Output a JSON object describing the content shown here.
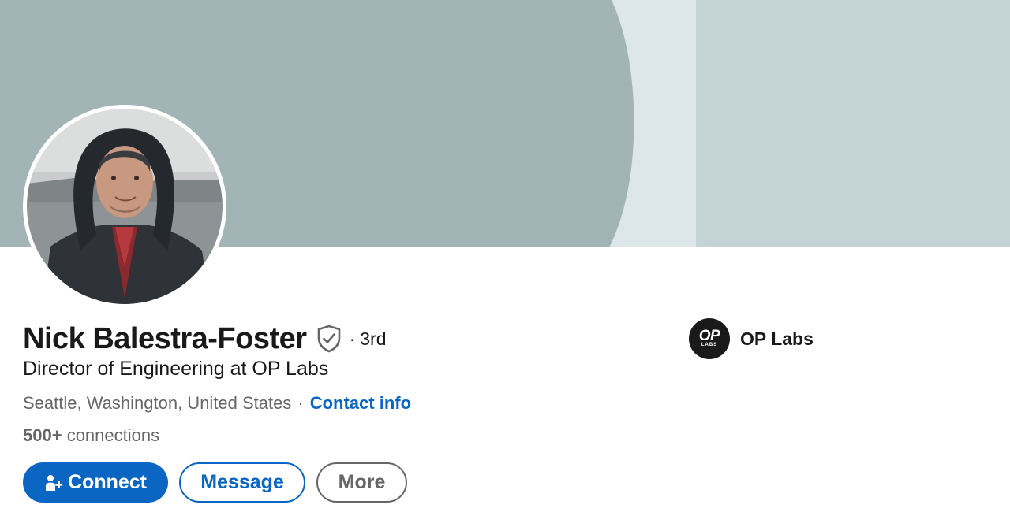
{
  "profile": {
    "name": "Nick Balestra-Foster",
    "degree_separator": "·",
    "degree": "3rd",
    "headline": "Director of Engineering at OP Labs",
    "location": "Seattle, Washington, United States",
    "location_separator": "·",
    "contact_info_label": "Contact info",
    "connections_count": "500+",
    "connections_label": "connections"
  },
  "actions": {
    "connect_label": "Connect",
    "message_label": "Message",
    "more_label": "More"
  },
  "company": {
    "logo_text_top": "OP",
    "logo_text_bottom": "LABS",
    "name": "OP Labs"
  },
  "colors": {
    "accent": "#0a66c2",
    "banner_dark": "#a3b4b7",
    "banner_light": "#dde6e9",
    "banner_right": "#c4d3d6",
    "text_primary": "#191919",
    "text_secondary": "#666666"
  },
  "icons": {
    "verified": "shield-check-icon",
    "connect": "add-person-icon"
  }
}
